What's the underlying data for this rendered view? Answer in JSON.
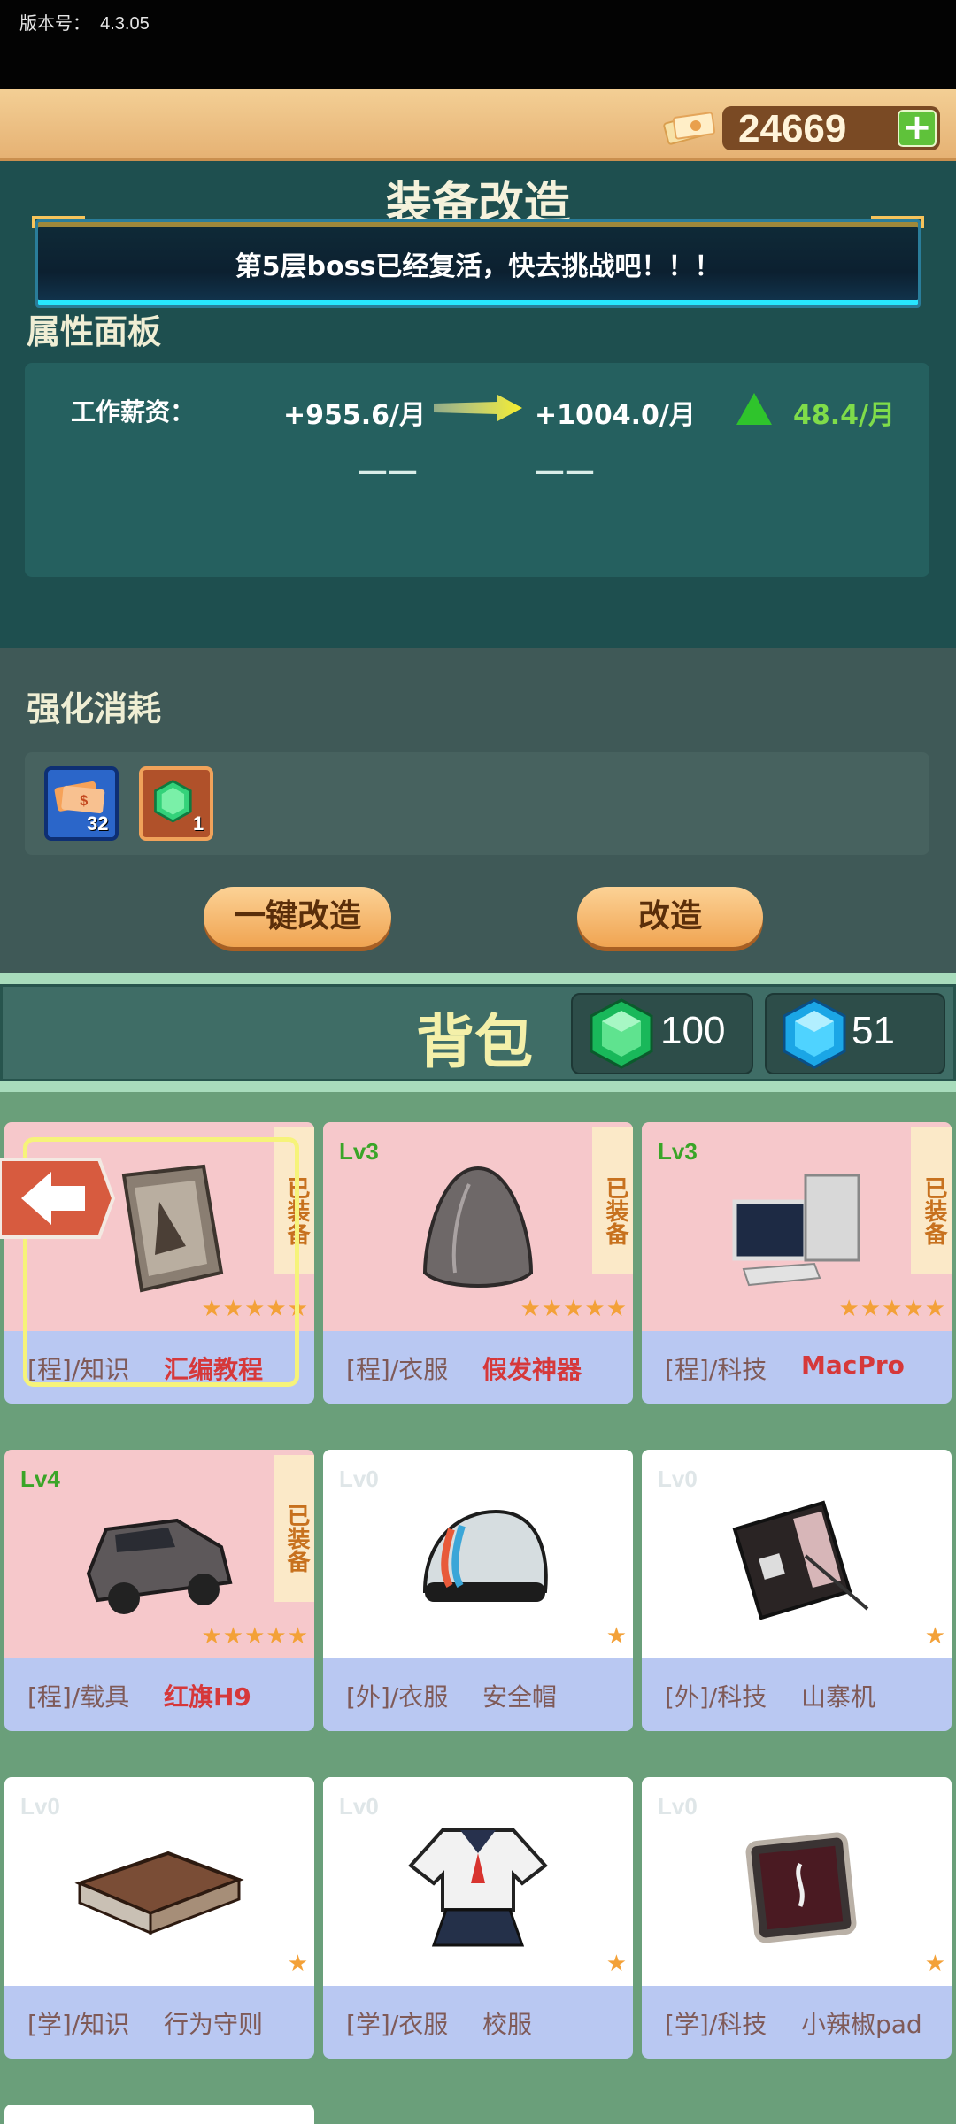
{
  "version": {
    "label": "版本号：",
    "value": "4.3.05"
  },
  "currency": {
    "coins": "24669",
    "add_label": "+"
  },
  "title": "装备改造",
  "notice": "第5层boss已经复活，快去挑战吧！！！",
  "attributes": {
    "title": "属性面板",
    "salary_label": "工作薪资：",
    "old_value": "+955.6/月",
    "new_value": "+1004.0/月",
    "delta": "48.4/月",
    "dash_old": "——",
    "dash_new": "——"
  },
  "cost": {
    "title": "强化消耗",
    "items": [
      {
        "icon": "cash-stack-icon",
        "count": "32"
      },
      {
        "icon": "green-gem-icon",
        "count": "1"
      }
    ]
  },
  "buttons": {
    "one_key": "一键改造",
    "modify": "改造"
  },
  "bag": {
    "title": "背包",
    "green_gems": "100",
    "blue_gems": "51"
  },
  "items": [
    {
      "level": "",
      "equipped": "已装备",
      "stars": "★★★★★",
      "category": "[程]/知识",
      "name": "汇编教程",
      "style": "pink",
      "icon": "book-icon"
    },
    {
      "level": "Lv3",
      "equipped": "已装备",
      "stars": "★★★★★",
      "category": "[程]/衣服",
      "name": "假发神器",
      "style": "pink",
      "icon": "wig-icon"
    },
    {
      "level": "Lv3",
      "equipped": "已装备",
      "stars": "★★★★★",
      "category": "[程]/科技",
      "name": "MacPro",
      "style": "pink",
      "icon": "computer-icon"
    },
    {
      "level": "Lv4",
      "equipped": "已装备",
      "stars": "★★★★★",
      "category": "[程]/载具",
      "name": "红旗H9",
      "style": "pink",
      "icon": "car-icon"
    },
    {
      "level": "Lv0",
      "equipped": "",
      "stars": "★",
      "category": "[外]/衣服",
      "name": "安全帽",
      "style": "white",
      "icon": "helmet-icon"
    },
    {
      "level": "Lv0",
      "equipped": "",
      "stars": "★",
      "category": "[外]/科技",
      "name": "山寨机",
      "style": "white",
      "icon": "phone-icon"
    },
    {
      "level": "Lv0",
      "equipped": "",
      "stars": "★",
      "category": "[学]/知识",
      "name": "行为守则",
      "style": "white",
      "icon": "rulebook-icon"
    },
    {
      "level": "Lv0",
      "equipped": "",
      "stars": "★",
      "category": "[学]/衣服",
      "name": "校服",
      "style": "white",
      "icon": "uniform-icon"
    },
    {
      "level": "Lv0",
      "equipped": "",
      "stars": "★",
      "category": "[学]/科技",
      "name": "小辣椒pad",
      "style": "white",
      "icon": "tablet-icon"
    }
  ]
}
